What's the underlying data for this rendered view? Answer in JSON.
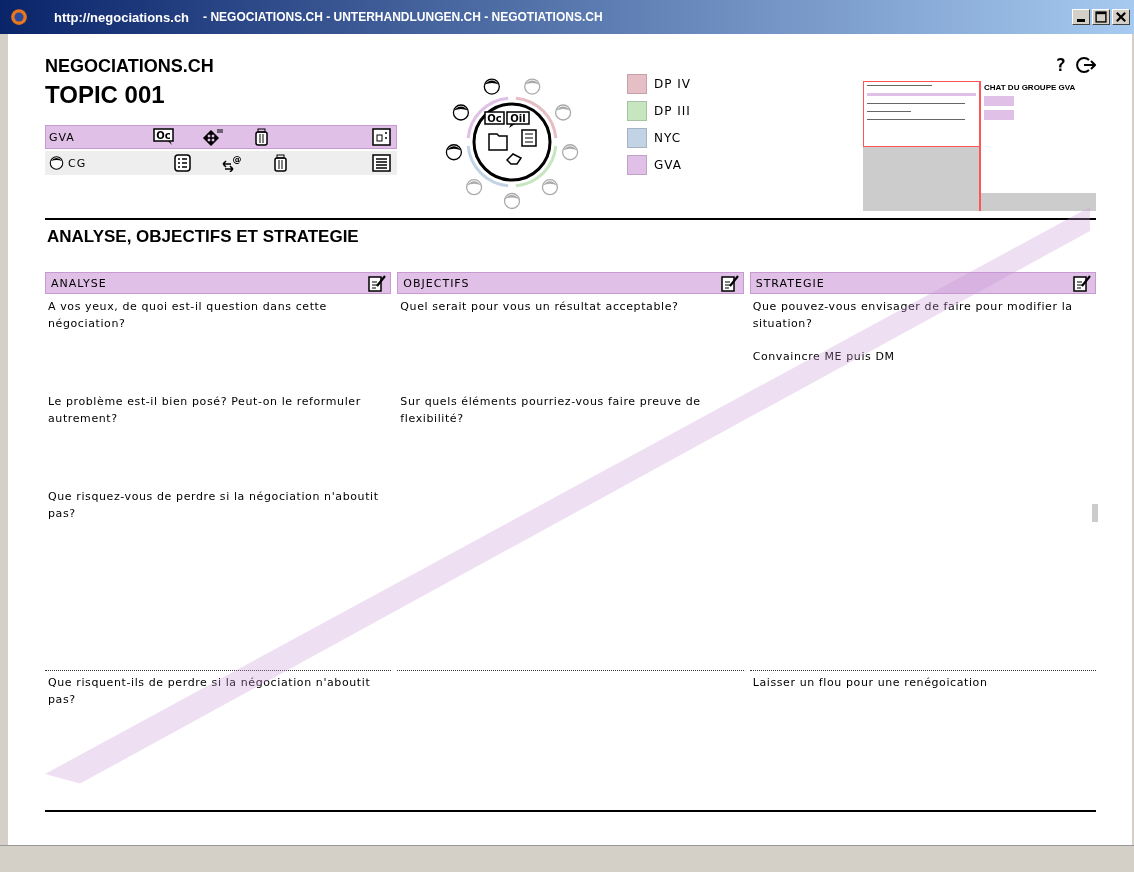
{
  "window": {
    "url": "http://negociations.ch",
    "title": "- NEGOCIATIONS.CH - UNTERHANDLUNGEN.CH - NEGOTIATIONS.CH"
  },
  "header": {
    "site": "NEGOCIATIONS.CH",
    "topic": "TOPIC 001",
    "help": "?"
  },
  "toolbar_rows": [
    {
      "label": "GVA",
      "selected": true,
      "avatar": false,
      "icons": [
        {
          "kind": "bubble",
          "text": "Oc"
        },
        {
          "kind": "move"
        },
        {
          "kind": "jar"
        },
        {
          "kind": "card"
        }
      ]
    },
    {
      "label": "CG",
      "selected": false,
      "avatar": true,
      "icons": [
        {
          "kind": "list"
        },
        {
          "kind": "swap",
          "text": "@"
        },
        {
          "kind": "jar"
        },
        {
          "kind": "lines"
        }
      ]
    }
  ],
  "hub": {
    "bubbles": [
      "Oc",
      "Oil"
    ],
    "participants": [
      {
        "active": true
      },
      {
        "active": false
      },
      {
        "active": false
      },
      {
        "active": false
      },
      {
        "active": false
      },
      {
        "active": false
      },
      {
        "active": false
      },
      {
        "active": true
      },
      {
        "active": true
      }
    ]
  },
  "legend": [
    {
      "label": "DP IV",
      "color": "#e6bfc6"
    },
    {
      "label": "DP III",
      "color": "#c6e6c0"
    },
    {
      "label": "NYC",
      "color": "#c2d3e6"
    },
    {
      "label": "GVA",
      "color": "#e0c0e6"
    }
  ],
  "preview": {
    "chat_title": "CHAT DU GROUPE GVA"
  },
  "section_title": "ANALYSE, OBJECTIFS ET STRATEGIE",
  "columns": [
    {
      "title": "ANALYSE",
      "blocks": [
        {
          "question": "A vos yeux, de quoi est-il question dans cette négociation?"
        },
        {
          "question": "Le problème est-il bien posé? Peut-on le reformuler autrement?"
        },
        {
          "question": "Que risquez-vous de perdre si la négociation n'aboutit pas?"
        }
      ],
      "lower": [
        "Que risquent-ils de perdre si la négociation n'aboutit pas?"
      ]
    },
    {
      "title": "OBJECTIFS",
      "blocks": [
        {
          "question": "Quel serait pour vous un résultat acceptable?"
        },
        {
          "question": "Sur quels éléments pourriez-vous faire preuve de flexibilité?"
        }
      ]
    },
    {
      "title": "STRATEGIE",
      "blocks": [
        {
          "question": "Que pouvez-vous envisager de faire pour modifier la situation?",
          "answer": "Convaincre ME puis DM"
        }
      ],
      "lower": [
        "Laisser un flou pour une renégoication"
      ]
    }
  ]
}
